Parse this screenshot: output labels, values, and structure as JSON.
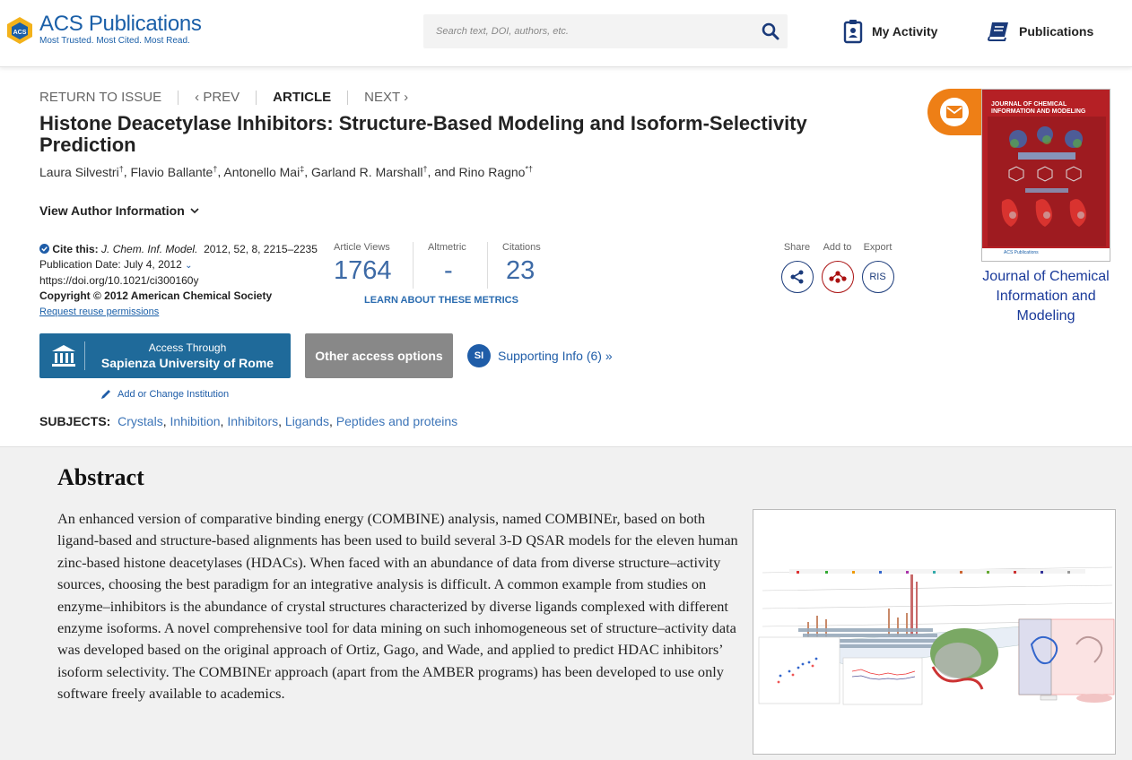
{
  "header": {
    "logo_title": "ACS Publications",
    "logo_tagline": "Most Trusted. Most Cited. Most Read.",
    "search_placeholder": "Search text, DOI, authors, etc.",
    "nav": {
      "my_activity": "My Activity",
      "publications": "Publications"
    }
  },
  "crumbs": {
    "return": "RETURN TO ISSUE",
    "prev": "PREV",
    "article": "ARTICLE",
    "next": "NEXT"
  },
  "article": {
    "title": "Histone Deacetylase Inhibitors: Structure-Based Modeling and Isoform-Selectivity Prediction",
    "authors": [
      {
        "name": "Laura Silvestri",
        "mark": "†"
      },
      {
        "name": "Flavio Ballante",
        "mark": "†"
      },
      {
        "name": "Antonello Mai",
        "mark": "‡"
      },
      {
        "name": "Garland R. Marshall",
        "mark": "†"
      },
      {
        "name": "Rino Ragno",
        "mark": "*†"
      }
    ],
    "view_author": "View Author Information",
    "cite_label": "Cite this:",
    "cite_journal": "J. Chem. Inf. Model.",
    "cite_rest": "2012, 52, 8, 2215–2235",
    "pub_date": "Publication Date: July 4, 2012",
    "doi": "https://doi.org/10.1021/ci300160y",
    "copyright": "Copyright © 2012 American Chemical Society",
    "reuse": "Request reuse permissions"
  },
  "metrics": {
    "views_label": "Article Views",
    "views": "1764",
    "altmetric_label": "Altmetric",
    "altmetric": "-",
    "citations_label": "Citations",
    "citations": "23",
    "learn": "LEARN ABOUT THESE METRICS"
  },
  "tools": {
    "share": "Share",
    "add_to": "Add to",
    "export": "Export",
    "ris": "RIS"
  },
  "access": {
    "line1": "Access Through",
    "line2": "Sapienza University of Rome",
    "other": "Other access options",
    "si_badge": "SI",
    "supporting": "Supporting Info (6) »",
    "add_institution": "Add or Change Institution"
  },
  "subjects": {
    "label": "SUBJECTS:",
    "items": [
      "Crystals",
      "Inhibition",
      "Inhibitors",
      "Ligands",
      "Peptides and proteins"
    ]
  },
  "journal": {
    "name": "Journal of Chemical Information and Modeling",
    "cover_title": "JOURNAL OF CHEMICAL INFORMATION AND MODELING",
    "cover_publisher": "ACS Publications"
  },
  "abstract": {
    "heading": "Abstract",
    "text": "An enhanced version of comparative binding energy (COMBINE) analysis, named COMBINEr, based on both ligand-based and structure-based alignments has been used to build several 3-D QSAR models for the eleven human zinc-based histone deacetylases (HDACs). When faced with an abundance of data from diverse structure–activity sources, choosing the best paradigm for an integrative analysis is difficult. A common example from studies on enzyme–inhibitors is the abundance of crystal structures characterized by diverse ligands complexed with different enzyme isoforms. A novel comprehensive tool for data mining on such inhomogeneous set of structure–activity data was developed based on the original approach of Ortiz, Gago, and Wade, and applied to predict HDAC inhibitors’ isoform selectivity. The COMBINEr approach (apart from the AMBER programs) has been developed to use only software freely available to academics."
  },
  "colors": {
    "brand_blue": "#1a5fa8",
    "access_blue": "#1f6a9a",
    "email_orange": "#ee7f16",
    "cover_red": "#b52025",
    "metric_blue": "#3d6aa6"
  }
}
